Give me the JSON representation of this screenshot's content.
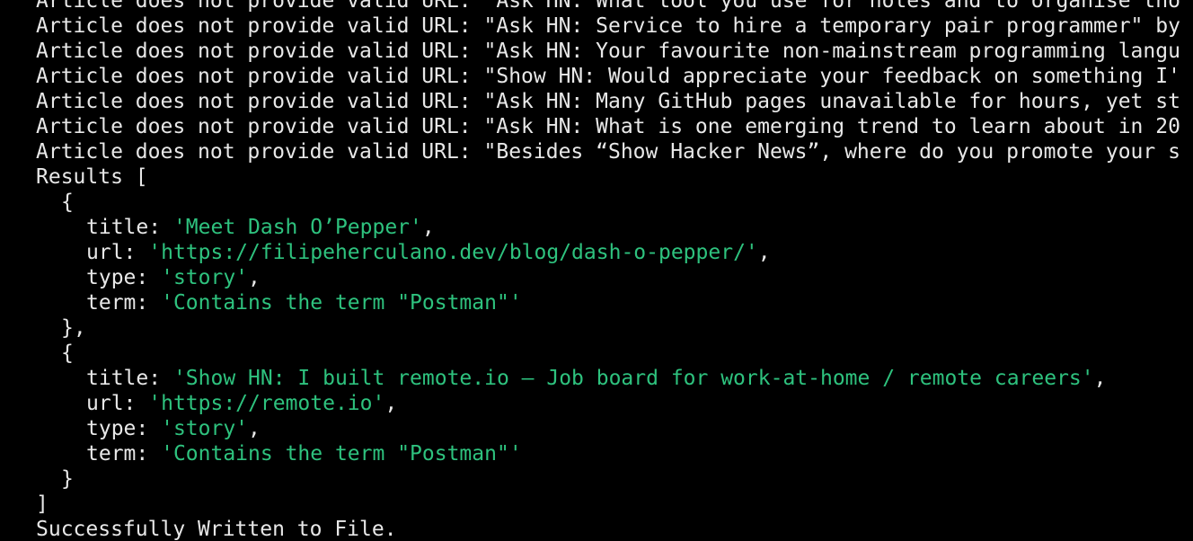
{
  "colors": {
    "background": "#000000",
    "text": "#e8e8e8",
    "string": "#2ec27e"
  },
  "warnings": [
    "Article does not provide valid URL: \"Ask HN: What tool you use for notes and to organise tho",
    "Article does not provide valid URL: \"Ask HN: Service to hire a temporary pair programmer\" by",
    "Article does not provide valid URL: \"Ask HN: Your favourite non-mainstream programming langu",
    "Article does not provide valid URL: \"Show HN: Would appreciate your feedback on something I'",
    "Article does not provide valid URL: \"Ask HN: Many GitHub pages unavailable for hours, yet st",
    "Article does not provide valid URL: \"Ask HN: What is one emerging trend to learn about in 20",
    "Article does not provide valid URL: \"Besides “Show Hacker News”, where do you promote your s"
  ],
  "results_open": "Results [",
  "results_close": "]",
  "brace_open": "{",
  "brace_close_comma": "},",
  "brace_close": "}",
  "key_title": "title: ",
  "key_url": "url: ",
  "key_type": "type: ",
  "key_term": "term: ",
  "comma": ",",
  "results": [
    {
      "title": "'Meet Dash O’Pepper'",
      "url": "'https://filipeherculano.dev/blog/dash-o-pepper/'",
      "type": "'story'",
      "term": "'Contains the term \"Postman\"'"
    },
    {
      "title": "'Show HN: I built remote.io – Job board for work-at-home / remote careers'",
      "url": "'https://remote.io'",
      "type": "'story'",
      "term": "'Contains the term \"Postman\"'"
    }
  ],
  "success_message": "Successfully Written to File."
}
